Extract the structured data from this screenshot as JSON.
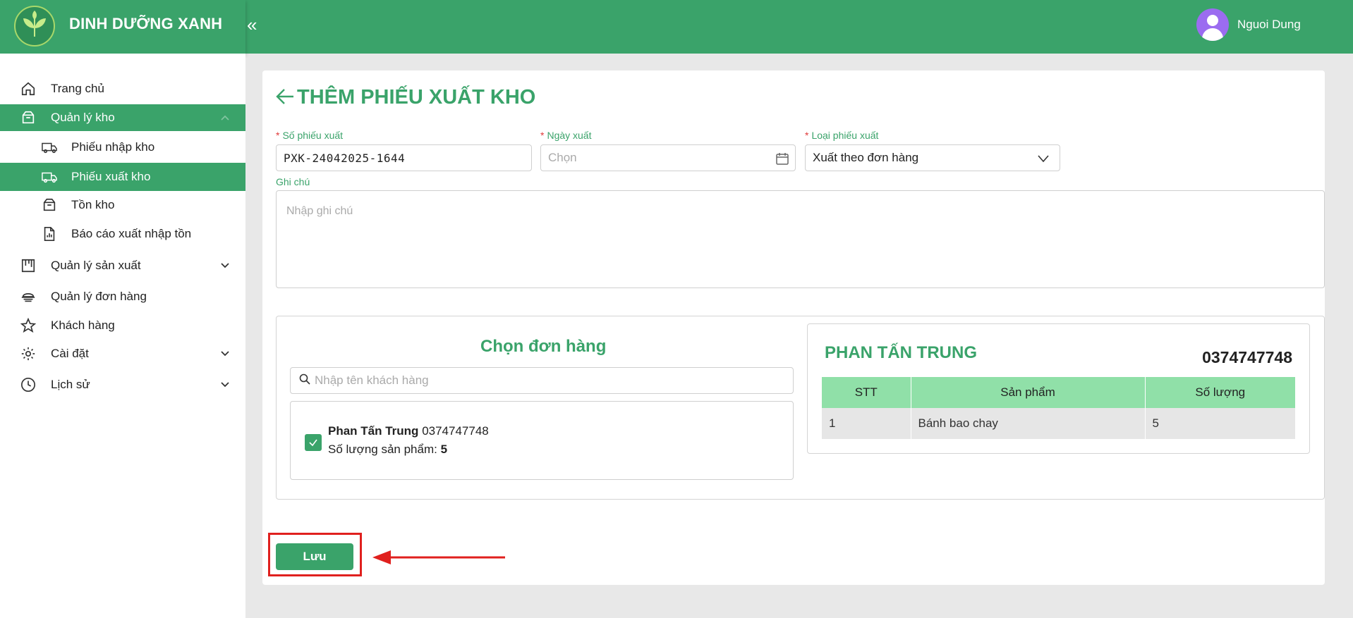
{
  "app": {
    "brand": "DINH DƯỠNG XANH",
    "collapse_glyph": "«",
    "accent": "#3aa36a"
  },
  "header": {
    "user_name": "Nguoi Dung"
  },
  "sidebar": {
    "items": [
      {
        "label": "Trang chủ",
        "icon": "home-icon"
      },
      {
        "label": "Quản lý kho",
        "icon": "box-icon",
        "expanded": true
      },
      {
        "label": "Phiếu nhập kho",
        "icon": "truck-in-icon"
      },
      {
        "label": "Phiếu xuất kho",
        "icon": "truck-out-icon",
        "active": true
      },
      {
        "label": "Tồn kho",
        "icon": "inventory-icon"
      },
      {
        "label": "Báo cáo xuất nhập tồn",
        "icon": "report-icon"
      },
      {
        "label": "Quản lý sản xuất",
        "icon": "factory-icon"
      },
      {
        "label": "Quản lý đơn hàng",
        "icon": "order-icon"
      },
      {
        "label": "Khách hàng",
        "icon": "star-icon"
      },
      {
        "label": "Cài đặt",
        "icon": "gear-icon"
      },
      {
        "label": "Lịch sử",
        "icon": "clock-icon"
      }
    ]
  },
  "page": {
    "title": "THÊM PHIẾU XUẤT KHO"
  },
  "form": {
    "slip_number": {
      "label": "Số phiếu xuất",
      "value": "PXK-24042025-1644",
      "required_mark": "*"
    },
    "export_date": {
      "label": "Ngày xuất",
      "placeholder": "Chọn",
      "required_mark": "*"
    },
    "export_type": {
      "label": "Loại phiếu xuất",
      "value": "Xuất theo đơn hàng",
      "required_mark": "*"
    },
    "note": {
      "label": "Ghi chú",
      "placeholder": "Nhập ghi chú"
    }
  },
  "order_picker": {
    "title": "Chọn đơn hàng",
    "search_placeholder": "Nhập tên khách hàng",
    "orders": [
      {
        "customer": "Phan Tấn Trung",
        "phone": "0374747748",
        "qty_label": "Số lượng sản phẩm:",
        "qty": "5",
        "checked": true
      }
    ]
  },
  "order_detail": {
    "customer": "PHAN TẤN TRUNG",
    "phone": "0374747748",
    "columns": [
      "STT",
      "Sản phẩm",
      "Số lượng"
    ],
    "rows": [
      [
        "1",
        "Bánh bao chay",
        "5"
      ]
    ]
  },
  "actions": {
    "save_label": "Lưu"
  }
}
